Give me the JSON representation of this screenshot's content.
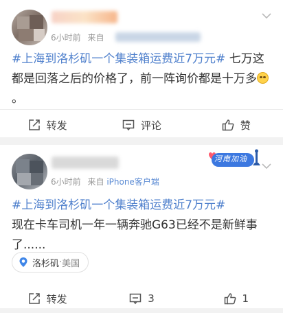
{
  "post1": {
    "time": "6小时前",
    "source_prefix": "来自",
    "hashtag": "#上海到洛杉矶一个集装箱运费近7万元#",
    "body": " 七万这都是回落之后的价格了，前一阵询价都是十万多",
    "actions": {
      "repost": "转发",
      "comment": "评论",
      "like": "赞"
    }
  },
  "post2": {
    "time": "6小时前",
    "source_prefix": "来自",
    "source": "iPhone客户端",
    "hashtag": "#上海到洛杉矶一个集装箱运费近7万元#",
    "body": "现在卡车司机一年一辆奔驰G63已经不是新鲜事了......",
    "location": {
      "city": "洛杉矶",
      "sep": " · ",
      "country": "美国"
    },
    "badge": "河南加油",
    "actions": {
      "repost": "转发",
      "comment": "3",
      "like": "1"
    }
  },
  "colors": {
    "link": "#4e7fcc",
    "meta": "#999999",
    "background": "#f2f2f2"
  },
  "icons": [
    "chevron-down-icon",
    "repost-icon",
    "comment-icon",
    "like-icon",
    "location-pin-icon"
  ]
}
